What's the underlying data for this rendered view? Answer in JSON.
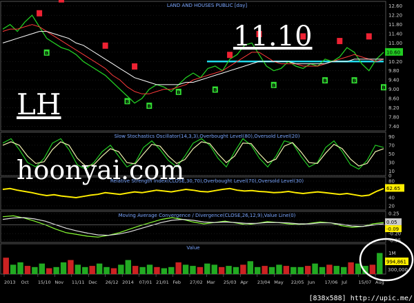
{
  "chart_data": [
    {
      "type": "line",
      "panel": "price",
      "title": "LAND AND HOUSES PUBLIC [day]",
      "price_labels": [
        "12.60",
        "12.20",
        "11.80",
        "11.40",
        "11.00",
        "10.60",
        "10.20",
        "9.80",
        "9.40",
        "9.00",
        "8.60",
        "8.20",
        "7.80",
        "7.40"
      ],
      "ylim": [
        7.2,
        12.8
      ],
      "last_value": "10.60",
      "x_labels": [
        "2013",
        "Oct",
        "15/10",
        "Nov",
        "11/11",
        "Dec",
        "26/12",
        "2014",
        "07/01",
        "21/01",
        "Feb",
        "27/02",
        "Mar",
        "25/03",
        "Apr",
        "23/04",
        "May",
        "22/05",
        "Jun",
        "17/06",
        "Jul",
        "15/07",
        "Aug"
      ],
      "series": [
        {
          "name": "price",
          "color": "#22cc22",
          "values": [
            11.6,
            11.8,
            11.5,
            11.9,
            12.2,
            11.7,
            11.2,
            11.0,
            10.8,
            10.7,
            10.5,
            10.2,
            10.0,
            9.8,
            9.6,
            9.3,
            9.0,
            8.7,
            8.4,
            8.6,
            9.0,
            9.2,
            9.1,
            8.9,
            9.2,
            9.5,
            9.7,
            9.5,
            9.9,
            10.0,
            9.8,
            10.3,
            10.5,
            10.9,
            11.0,
            10.5,
            10.0,
            9.8,
            9.9,
            10.2,
            10.0,
            9.9,
            10.1,
            10.0,
            10.3,
            10.2,
            10.4,
            10.8,
            10.6,
            10.1,
            9.8,
            10.3,
            10.6
          ]
        },
        {
          "name": "ma-short",
          "color": "#ff3b3b",
          "values": [
            11.5,
            11.6,
            11.6,
            11.7,
            11.8,
            11.7,
            11.5,
            11.3,
            11.1,
            10.9,
            10.7,
            10.5,
            10.3,
            10.1,
            9.9,
            9.6,
            9.4,
            9.1,
            8.9,
            8.8,
            8.8,
            8.9,
            9.0,
            9.0,
            9.1,
            9.2,
            9.4,
            9.5,
            9.6,
            9.7,
            9.8,
            10.0,
            10.2,
            10.4,
            10.6,
            10.6,
            10.4,
            10.2,
            10.1,
            10.1,
            10.1,
            10.0,
            10.0,
            10.0,
            10.1,
            10.2,
            10.3,
            10.4,
            10.5,
            10.4,
            10.3,
            10.2,
            10.3
          ]
        },
        {
          "name": "ma-long",
          "color": "#ffffff",
          "values": [
            11.0,
            11.1,
            11.2,
            11.3,
            11.4,
            11.5,
            11.5,
            11.4,
            11.3,
            11.2,
            11.0,
            10.9,
            10.7,
            10.5,
            10.3,
            10.1,
            9.9,
            9.7,
            9.5,
            9.4,
            9.3,
            9.2,
            9.2,
            9.2,
            9.2,
            9.3,
            9.3,
            9.4,
            9.5,
            9.6,
            9.7,
            9.8,
            9.9,
            10.0,
            10.1,
            10.2,
            10.2,
            10.2,
            10.2,
            10.2,
            10.1,
            10.1,
            10.1,
            10.1,
            10.1,
            10.2,
            10.2,
            10.2,
            10.3,
            10.3,
            10.3,
            10.3,
            10.3
          ]
        }
      ],
      "trendline_value": 10.2,
      "buy_markers": [
        {
          "x": 6,
          "y": 10.6
        },
        {
          "x": 17,
          "y": 8.5
        },
        {
          "x": 20,
          "y": 8.3
        },
        {
          "x": 24,
          "y": 8.9
        },
        {
          "x": 29,
          "y": 9.0
        },
        {
          "x": 37,
          "y": 9.2
        },
        {
          "x": 44,
          "y": 9.4
        },
        {
          "x": 48,
          "y": 9.4
        },
        {
          "x": 52,
          "y": 9.1
        }
      ],
      "sell_markers": [
        {
          "x": 5,
          "y": 12.3
        },
        {
          "x": 8,
          "y": 12.9
        },
        {
          "x": 14,
          "y": 10.9
        },
        {
          "x": 18,
          "y": 10.0
        },
        {
          "x": 31,
          "y": 10.5
        },
        {
          "x": 35,
          "y": 11.4
        },
        {
          "x": 41,
          "y": 11.3
        },
        {
          "x": 46,
          "y": 11.1
        },
        {
          "x": 50,
          "y": 11.3
        }
      ],
      "buy_label": "B"
    },
    {
      "type": "line",
      "panel": "stochastic",
      "title": "Slow Stochastics Oscillator(14,3,3),Overbought Level(80),Oversold Level(20)",
      "ylim": [
        0,
        100
      ],
      "levels": [
        "90",
        "70",
        "50",
        "30",
        "10",
        "0"
      ],
      "series": [
        {
          "name": "%K",
          "color": "#22cc22",
          "values": [
            75,
            85,
            60,
            30,
            20,
            40,
            75,
            85,
            60,
            25,
            15,
            30,
            55,
            70,
            45,
            20,
            30,
            65,
            80,
            60,
            35,
            20,
            45,
            75,
            85,
            70,
            40,
            20,
            55,
            85,
            70,
            40,
            20,
            45,
            80,
            75,
            45,
            20,
            30,
            65,
            80,
            55,
            25,
            15,
            35,
            70,
            65
          ]
        },
        {
          "name": "%D",
          "color": "#f2f2b0",
          "values": [
            70,
            78,
            70,
            45,
            28,
            32,
            60,
            78,
            70,
            40,
            22,
            25,
            45,
            62,
            55,
            30,
            27,
            50,
            72,
            68,
            45,
            28,
            37,
            62,
            78,
            74,
            50,
            30,
            45,
            75,
            74,
            50,
            30,
            38,
            68,
            76,
            55,
            30,
            28,
            52,
            72,
            62,
            38,
            22,
            28,
            55,
            62
          ]
        }
      ]
    },
    {
      "type": "line",
      "panel": "rsi",
      "title": "Relative Strength Index(CLOSE,30,70),Overbought Level(70),Oversold Level(30)",
      "ylim": [
        10,
        90
      ],
      "levels": [
        "80",
        "60",
        "40",
        "20"
      ],
      "last_value": "62.65",
      "series": [
        {
          "name": "RSI",
          "color": "#ffee00",
          "values": [
            60,
            62,
            58,
            55,
            52,
            48,
            45,
            47,
            44,
            42,
            40,
            43,
            46,
            48,
            52,
            50,
            48,
            51,
            54,
            52,
            55,
            58,
            56,
            54,
            57,
            60,
            58,
            55,
            54,
            57,
            60,
            62,
            58,
            56,
            57,
            55,
            54,
            52,
            53,
            55,
            52,
            50,
            52,
            54,
            52,
            50,
            48,
            50,
            47,
            44,
            46,
            55,
            62
          ]
        }
      ]
    },
    {
      "type": "line",
      "panel": "macd",
      "title": "Moving Average Convergence / Divergence(CLOSE,26,12,9),Value Line(0)",
      "ylim": [
        -0.4,
        0.3
      ],
      "levels": [
        "0.25",
        "0.10",
        "-0.05",
        "-0.20",
        "-0.35"
      ],
      "last_value": "0.05",
      "last_value_2": "-0.09",
      "series": [
        {
          "name": "MACD",
          "color": "#88ff33",
          "values": [
            0.18,
            0.2,
            0.15,
            0.08,
            0.0,
            -0.1,
            -0.18,
            -0.22,
            -0.26,
            -0.28,
            -0.24,
            -0.18,
            -0.1,
            -0.02,
            0.05,
            0.12,
            0.16,
            0.12,
            0.06,
            0.02,
            0.05,
            0.08,
            0.04,
            0.0,
            0.03,
            0.07,
            0.05,
            0.02,
            0.0,
            0.03,
            0.06,
            0.04,
            -0.02,
            -0.06,
            -0.04,
            0.02,
            0.05
          ]
        },
        {
          "name": "Signal",
          "color": "#e0e0e0",
          "values": [
            0.12,
            0.15,
            0.16,
            0.13,
            0.08,
            0.0,
            -0.08,
            -0.14,
            -0.19,
            -0.23,
            -0.24,
            -0.21,
            -0.16,
            -0.09,
            -0.02,
            0.05,
            0.1,
            0.12,
            0.1,
            0.06,
            0.05,
            0.06,
            0.05,
            0.03,
            0.03,
            0.05,
            0.05,
            0.04,
            0.02,
            0.02,
            0.04,
            0.04,
            0.01,
            -0.03,
            -0.04,
            -0.01,
            0.02
          ]
        }
      ]
    },
    {
      "type": "bar",
      "panel": "volume",
      "title": "Value",
      "levels": [
        "1M",
        "300,000"
      ],
      "last_value": "994,861",
      "values": [
        0.7,
        0.4,
        0.5,
        0.35,
        0.3,
        0.45,
        0.25,
        0.3,
        0.5,
        0.6,
        0.4,
        0.3,
        0.35,
        0.45,
        0.3,
        0.25,
        0.4,
        0.6,
        0.35,
        0.3,
        0.4,
        0.3,
        0.25,
        0.3,
        0.5,
        0.4,
        0.35,
        0.3,
        0.45,
        0.4,
        0.3,
        0.35,
        0.3,
        0.4,
        0.55,
        0.3,
        0.35,
        0.3,
        0.4,
        0.35,
        0.3,
        0.3,
        0.35,
        0.45,
        0.3,
        0.4,
        0.35,
        0.3,
        0.5,
        0.45,
        0.35,
        0.4,
        0.9
      ]
    }
  ],
  "overlays": {
    "price_note": "11.10",
    "ticker": "LH",
    "website": "hoonyai.com"
  },
  "watermark": "[838x588] http://upic.me/",
  "colors": {
    "grid": "#333333",
    "panel_border": "#555555",
    "trendline": "#22ddee",
    "buy": "#33dd33",
    "sell": "#ee2233",
    "title": "#7aa6ff",
    "axis_text": "#cccccc"
  }
}
